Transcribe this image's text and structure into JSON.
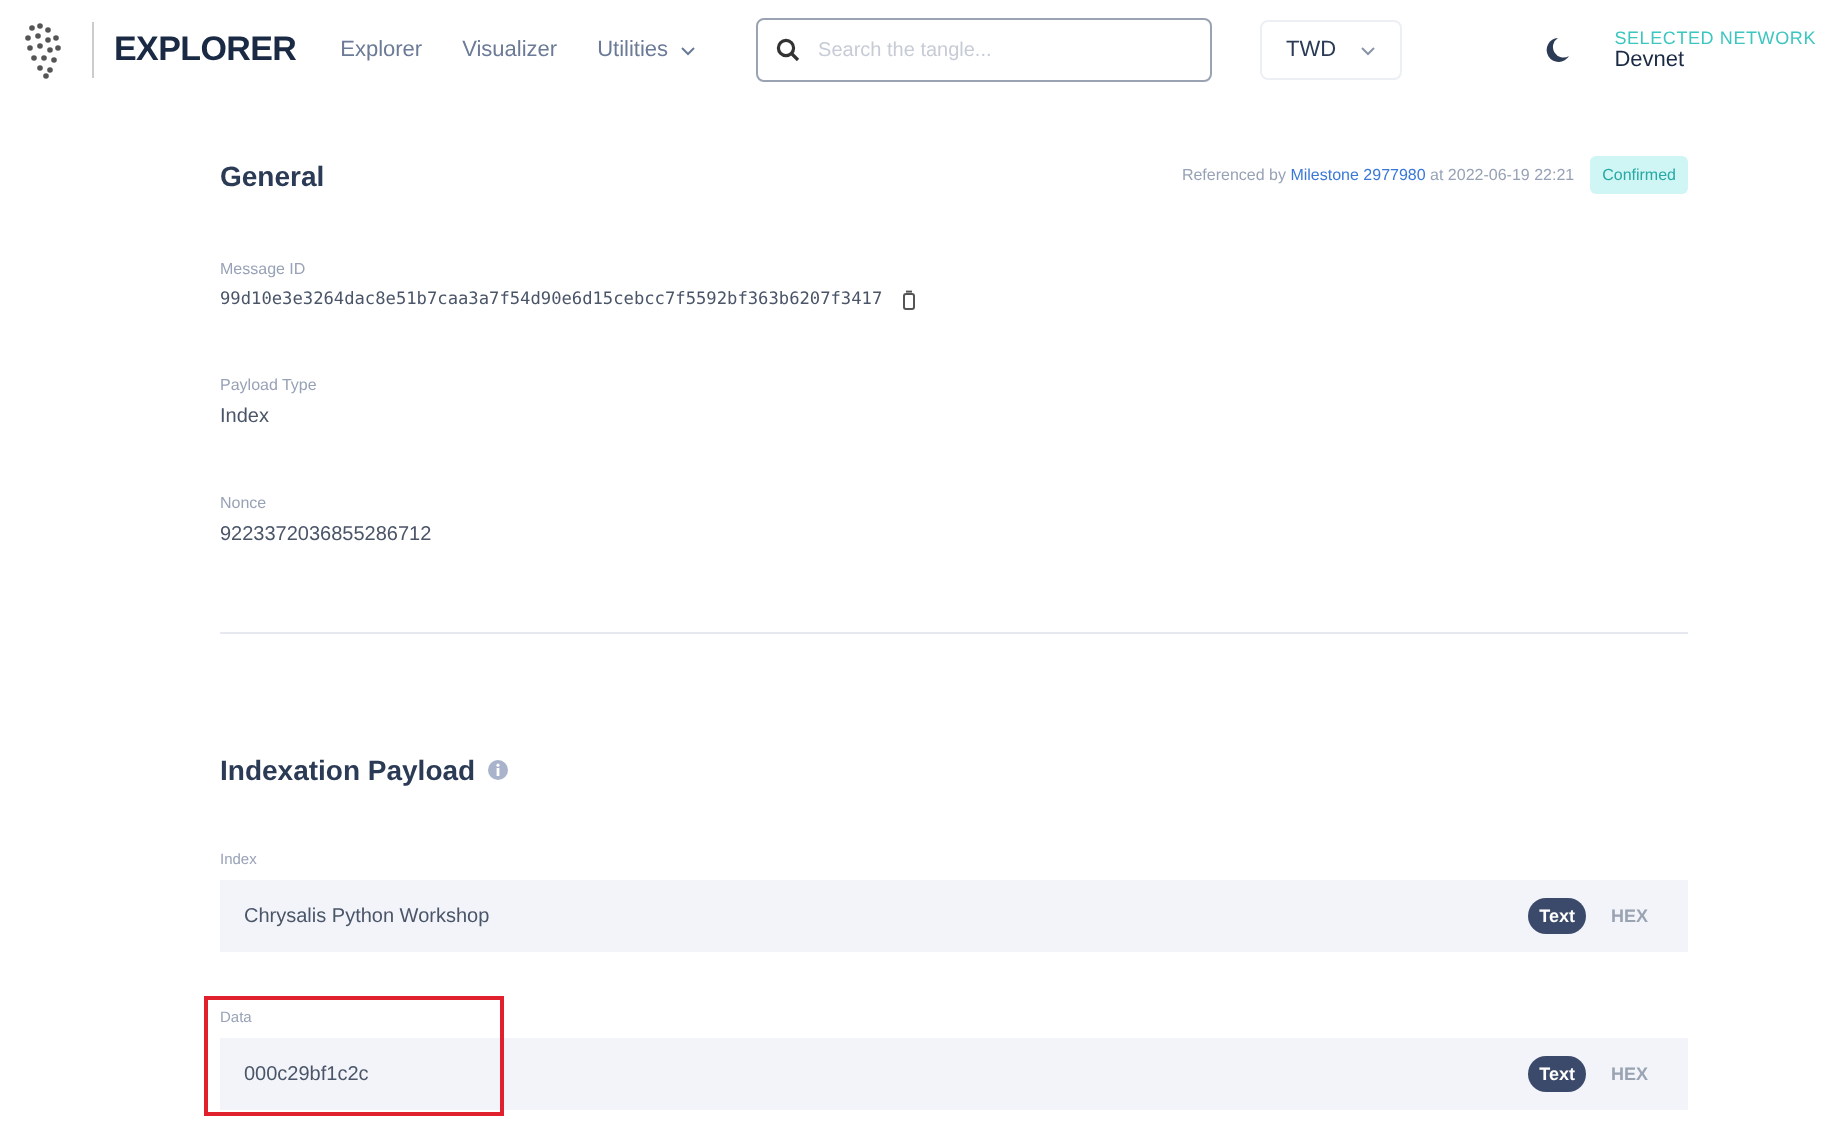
{
  "header": {
    "brand": "EXPLORER",
    "nav": [
      {
        "label": "Explorer",
        "dropdown": false
      },
      {
        "label": "Visualizer",
        "dropdown": false
      },
      {
        "label": "Utilities",
        "dropdown": true
      }
    ],
    "search": {
      "placeholder": "Search the tangle..."
    },
    "currency": "TWD",
    "network_label": "SELECTED NETWORK",
    "network": "Devnet"
  },
  "general": {
    "title": "General",
    "referenced_prefix": "Referenced by",
    "milestone": "Milestone 2977980",
    "referenced_suffix": "at 2022-06-19 22:21",
    "status": "Confirmed",
    "fields": [
      {
        "label": "Message ID",
        "value": "99d10e3e3264dac8e51b7caa3a7f54d90e6d15cebcc7f5592bf363b6207f3417",
        "copy": true
      },
      {
        "label": "Payload Type",
        "value": "Index",
        "copy": false
      },
      {
        "label": "Nonce",
        "value": "9223372036855286712",
        "copy": false
      }
    ]
  },
  "indexation": {
    "title": "Indexation Payload",
    "rows": [
      {
        "label": "Index",
        "value": "Chrysalis Python Workshop",
        "highlighted": false,
        "formats": [
          {
            "label": "Text",
            "selected": true
          },
          {
            "label": "HEX",
            "selected": false
          }
        ]
      },
      {
        "label": "Data",
        "value": "000c29bf1c2c",
        "highlighted": true,
        "formats": [
          {
            "label": "Text",
            "selected": true
          },
          {
            "label": "HEX",
            "selected": false
          }
        ]
      }
    ]
  }
}
